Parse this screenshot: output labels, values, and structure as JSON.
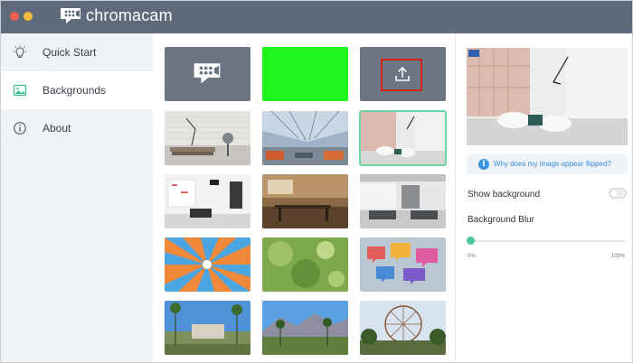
{
  "app": {
    "name": "chromacam",
    "colors": {
      "titlebar": "#5f6b7b",
      "accent": "#4bc59a",
      "link": "#3a8edb"
    }
  },
  "sidebar": {
    "items": [
      {
        "label": "Quick Start",
        "icon": "lightbulb-icon",
        "active": false
      },
      {
        "label": "Backgrounds",
        "icon": "image-icon",
        "active": true
      },
      {
        "label": "About",
        "icon": "info-icon",
        "active": false
      }
    ]
  },
  "backgrounds": {
    "tiles": [
      {
        "kind": "chromacam-logo",
        "icon": "chromacam-logo-icon"
      },
      {
        "kind": "green-screen",
        "color": "#1ff51c"
      },
      {
        "kind": "upload",
        "icon": "upload-icon"
      },
      {
        "kind": "photo",
        "scene": "white brick wall with lamp and fan"
      },
      {
        "kind": "photo",
        "scene": "office with glass ceiling"
      },
      {
        "kind": "photo",
        "scene": "bright lounge",
        "selected": true
      },
      {
        "kind": "photo",
        "scene": "white office room"
      },
      {
        "kind": "photo",
        "scene": "wooden cafe"
      },
      {
        "kind": "photo",
        "scene": "open office"
      },
      {
        "kind": "photo",
        "scene": "blue and orange sunburst"
      },
      {
        "kind": "photo",
        "scene": "green bokeh"
      },
      {
        "kind": "photo",
        "scene": "speech bubbles bokeh"
      },
      {
        "kind": "photo",
        "scene": "palm trees and building"
      },
      {
        "kind": "photo",
        "scene": "mountains and palms"
      },
      {
        "kind": "photo",
        "scene": "ferris wheel and palms"
      }
    ]
  },
  "panel": {
    "info_link": "Why does my image appear flipped?",
    "show_background": {
      "label": "Show background",
      "on": false
    },
    "blur": {
      "label": "Background Blur",
      "value": 0,
      "min_label": "0%",
      "max_label": "100%"
    }
  }
}
